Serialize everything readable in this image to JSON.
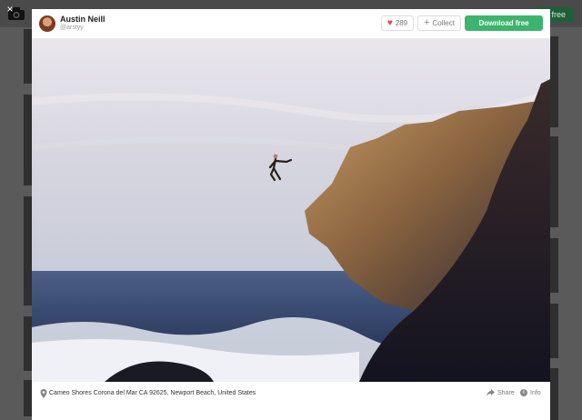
{
  "background": {
    "join_label": "n free"
  },
  "modal": {
    "close_glyph": "×",
    "user": {
      "name": "Austin Neill",
      "handle": "@arstyy"
    },
    "actions": {
      "like_count": "289",
      "collect_label": "Collect",
      "download_label": "Download free"
    },
    "footer": {
      "location": "Cameo Shores Corona del Mar CA 92625, Newport Beach, United States",
      "share_label": "Share",
      "info_label": "Info"
    }
  },
  "icons": {
    "close": "close-icon",
    "like": "heart-icon",
    "collect": "plus-icon",
    "location": "location-pin-icon",
    "share": "share-icon",
    "info": "info-icon",
    "camera": "camera-icon"
  },
  "colors": {
    "accent": "#3cb46e",
    "heart": "#e2434b",
    "overlay": "#3a3a3a"
  }
}
